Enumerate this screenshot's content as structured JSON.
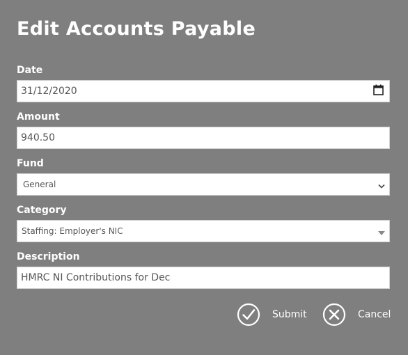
{
  "dialog": {
    "title": "Edit Accounts Payable"
  },
  "form": {
    "date": {
      "label": "Date",
      "value": "31/12/2020"
    },
    "amount": {
      "label": "Amount",
      "value": "940.50"
    },
    "fund": {
      "label": "Fund",
      "selected": "General"
    },
    "category": {
      "label": "Category",
      "selected": "Staffing: Employer's NIC"
    },
    "description": {
      "label": "Description",
      "value": "HMRC NI Contributions for Dec"
    }
  },
  "actions": {
    "submit_label": "Submit",
    "cancel_label": "Cancel"
  },
  "icons": {
    "date_picker": "calendar-icon",
    "fund_dropdown": "chevron-down-icon",
    "category_dropdown": "caret-down-icon",
    "submit": "check-circle-icon",
    "cancel": "close-circle-icon"
  },
  "colors": {
    "dialog_background": "#7f7f7f",
    "text": "#ffffff",
    "field_background": "#ffffff",
    "field_text": "#555555"
  }
}
